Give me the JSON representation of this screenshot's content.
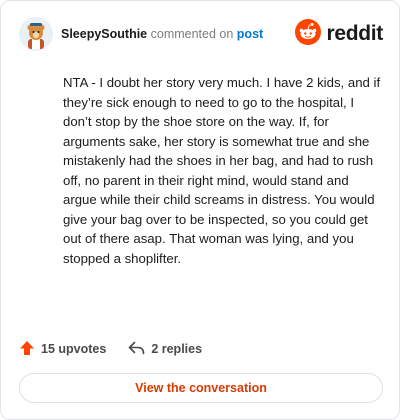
{
  "header": {
    "username": "SleepySouthie",
    "action_text": "commented on",
    "post_link": "post",
    "brand": "reddit"
  },
  "comment": {
    "body": "NTA - I doubt her story very much. I have 2 kids, and if they’re sick enough to need to go to the hospital, I don’t stop by the shoe store on the way. If, for arguments sake, her story is somewhat true and she mistakenly had the shoes in her bag, and had to rush off, no parent in their right mind, would stand and argue while their child screams in distress. You would give your bag over to be inspected, so you could get out of there asap. That woman was lying, and you stopped a shoplifter."
  },
  "actions": {
    "upvotes_label": "15 upvotes",
    "replies_label": "2 replies"
  },
  "cta": {
    "label": "View the conversation"
  },
  "colors": {
    "brand_orange": "#ff4500",
    "link_blue": "#0079d3",
    "cta_text": "#d93a00"
  },
  "icons": [
    "avatar",
    "reddit-snoo-icon",
    "upvote-arrow-icon",
    "reply-arrow-icon"
  ]
}
